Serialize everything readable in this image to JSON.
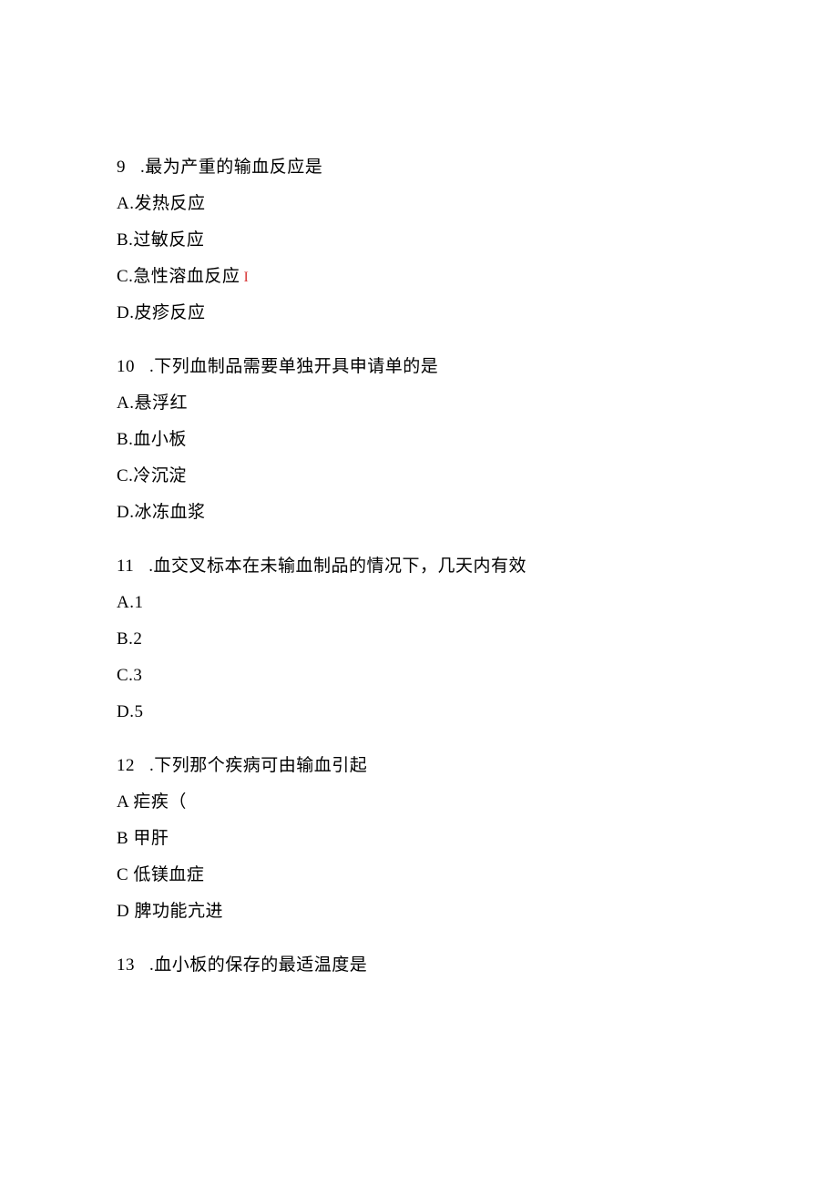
{
  "questions": [
    {
      "number": "9",
      "stem": ".最为产重的输血反应是",
      "options": [
        {
          "label": "A.发热反应",
          "marker": ""
        },
        {
          "label": "B.过敏反应",
          "marker": ""
        },
        {
          "label": "C.急性溶血反应",
          "marker": "I",
          "marker_type": "red"
        },
        {
          "label": "D.皮疹反应",
          "marker": ""
        }
      ]
    },
    {
      "number": "10",
      "stem": ".下列血制品需要单独开具申请单的是",
      "options": [
        {
          "label": "A.悬浮红",
          "marker": ""
        },
        {
          "label": "B.血小板",
          "marker": ""
        },
        {
          "label": "C.冷沉淀",
          "marker": ""
        },
        {
          "label": "D.冰冻血浆",
          "marker": ""
        }
      ]
    },
    {
      "number": "11",
      "stem": ".血交叉标本在未输血制品的情况下，几天内有效",
      "options": [
        {
          "label": "A.1",
          "marker": ""
        },
        {
          "label": "B.2",
          "marker": ""
        },
        {
          "label": "C.3",
          "marker": ""
        },
        {
          "label": "D.5",
          "marker": ""
        }
      ]
    },
    {
      "number": "12",
      "stem": ".下列那个疾病可由输血引起",
      "options": [
        {
          "label": "A 疟疾（",
          "marker": ""
        },
        {
          "label": "B 甲肝",
          "marker": ""
        },
        {
          "label": "C 低镁血症",
          "marker": ""
        },
        {
          "label": "D 脾功能亢进",
          "marker": ""
        }
      ]
    },
    {
      "number": "13",
      "stem": ".血小板的保存的最适温度是",
      "options": []
    }
  ]
}
